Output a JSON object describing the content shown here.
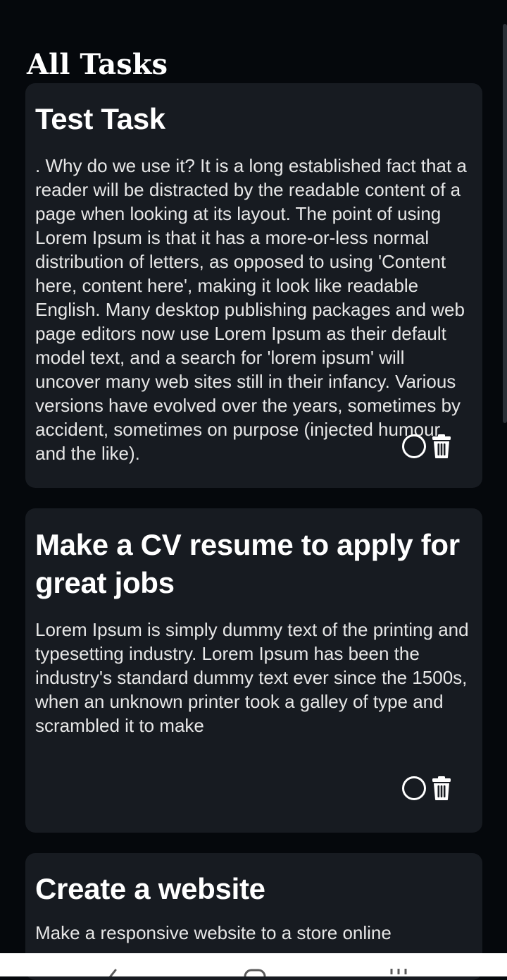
{
  "page": {
    "title": "All Tasks"
  },
  "tasks": [
    {
      "title": "Test Task",
      "description": ". Why do we use it? It is a long established fact that a reader will be distracted by the readable content of a page when looking at its layout. The point of using Lorem Ipsum is that it has a more-or-less normal distribution of letters, as opposed to using 'Content here, content here', making it look like readable English. Many desktop publishing packages and web page editors now use Lorem Ipsum as their default model text, and a search for 'lorem ipsum' will uncover many web sites still in their infancy. Various versions have evolved over the years, sometimes by accident, sometimes on purpose (injected humour and the like).",
      "completed": false
    },
    {
      "title": "Make a CV resume to apply for great jobs",
      "description": "Lorem Ipsum is simply dummy text of the printing and typesetting industry. Lorem Ipsum has been the industry's standard dummy text ever since the 1500s, when an unknown printer took a galley of type and scrambled it to make",
      "completed": false
    },
    {
      "title": "Create a website",
      "description": "Make a responsive website to a store online",
      "completed": false
    }
  ],
  "icons": {
    "complete": "circle-outline-icon",
    "delete": "trash-icon",
    "nav_back": "chevron-left-icon",
    "nav_home": "home-icon",
    "nav_recents": "recents-icon"
  },
  "colors": {
    "background": "#05080c",
    "card": "#171b21",
    "text": "#ffffff",
    "nav_bar": "#ffffff"
  }
}
